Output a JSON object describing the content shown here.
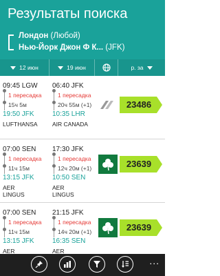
{
  "header": {
    "title": "Результаты поиска",
    "from": {
      "city": "Лондон",
      "sub": " (Любой)"
    },
    "to": {
      "city": "Нью-Йорк Джон Ф К...",
      "sub": " (JFK)"
    }
  },
  "filters": {
    "depart_date": "12 июн",
    "return_date": "19 июн",
    "price_sort": "р. за"
  },
  "results": [
    {
      "out": {
        "dep": "09:45 LGW",
        "stops": "1 пересадка",
        "duration": "15ч 5м",
        "arr": "19:50 JFK",
        "airline": "LUFTHANSA"
      },
      "back": {
        "dep": "06:40 JFK",
        "stops": "1 пересадка",
        "duration": "20ч 55м (+1)",
        "arr": "10:35 LHR",
        "airline": "AIR CANADA"
      },
      "price": "23486"
    },
    {
      "out": {
        "dep": "07:00 SEN",
        "stops": "1 пересадка",
        "duration": "11ч 15м",
        "arr": "13:15 JFK",
        "airline": "AER LINGUS"
      },
      "back": {
        "dep": "17:30 JFK",
        "stops": "1 пересадка",
        "duration": "12ч 20м (+1)",
        "arr": "10:50 SEN",
        "airline": "AER LINGUS"
      },
      "price": "23639"
    },
    {
      "out": {
        "dep": "07:00 SEN",
        "stops": "1 пересадка",
        "duration": "11ч 15м",
        "arr": "13:15 JFK",
        "airline": "AER LINGUS"
      },
      "back": {
        "dep": "21:15 JFK",
        "stops": "1 пересадка",
        "duration": "14ч 20м (+1)",
        "arr": "16:35 SEN",
        "airline": "AER LINGUS"
      },
      "price": "23639"
    }
  ],
  "colors": {
    "accent": "#1aa29a",
    "price_tag": "#a8e02a",
    "stops": "#e53935"
  },
  "appbar": {
    "icons": [
      "pin-icon",
      "chart-icon",
      "filter-icon",
      "sort-icon"
    ],
    "more": "..."
  }
}
